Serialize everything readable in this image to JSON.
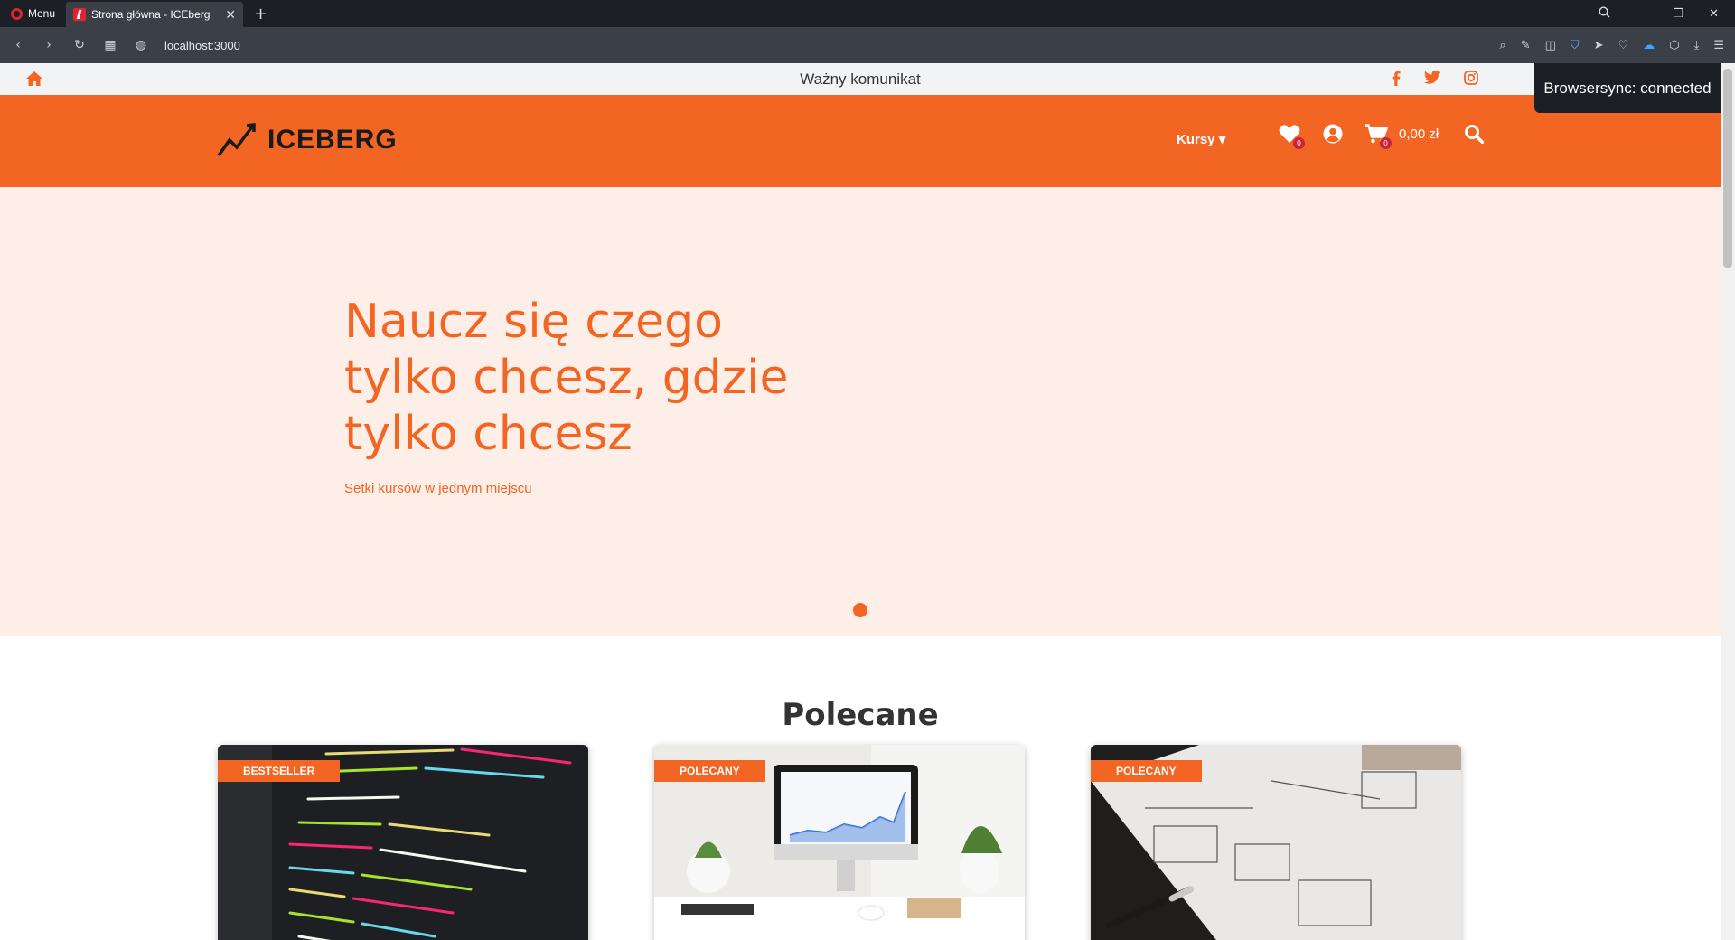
{
  "browser": {
    "menu_label": "Menu",
    "tab_title": "Strona główna - ICEberg",
    "url": "localhost:3000"
  },
  "announcement": {
    "text": "Ważny komunikat",
    "icons": [
      "home-icon",
      "facebook-icon",
      "twitter-icon",
      "instagram-icon"
    ]
  },
  "header": {
    "logo_text": "ICEBERG",
    "nav_kursy": "Kursy",
    "wishlist_count": "0",
    "cart_count": "0",
    "cart_total": "0,00 zł",
    "brand_color": "#f26522"
  },
  "hero": {
    "title": "Naucz się czego tylko chcesz, gdzie tylko chcesz",
    "subtitle": "Setki kursów w jednym miejscu"
  },
  "featured": {
    "title": "Polecane",
    "cards": [
      {
        "tag": "BESTSELLER"
      },
      {
        "tag": "POLECANY"
      },
      {
        "tag": "POLECANY"
      }
    ]
  },
  "browsersync": {
    "text": "Browsersync: connected"
  }
}
